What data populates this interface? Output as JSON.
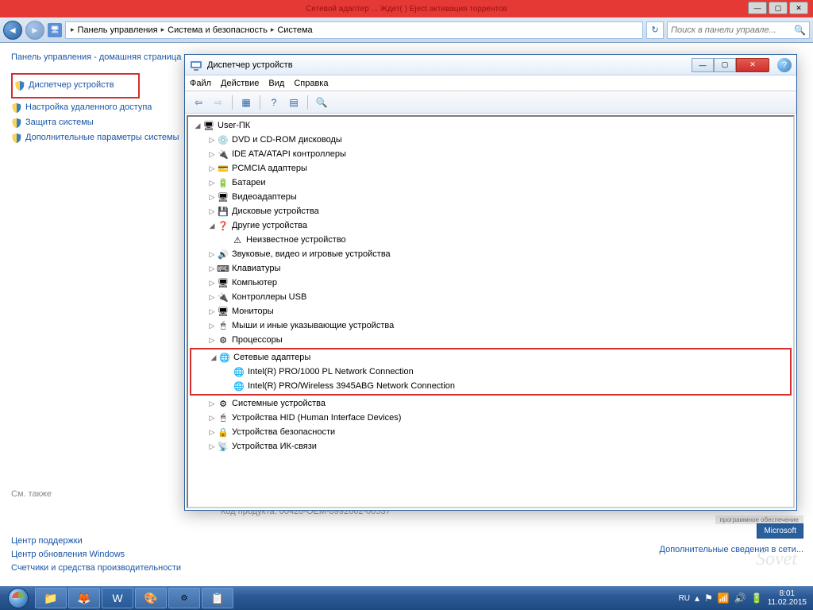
{
  "banner": {
    "center_text": "Сетевой адаптер ... Ждет( ) Eject активация торрентов",
    "min": "—",
    "max": "▢",
    "close": "✕"
  },
  "breadcrumb": {
    "items": [
      "Панель управления",
      "Система и безопасность",
      "Система"
    ]
  },
  "search": {
    "placeholder": "Поиск в панели управле..."
  },
  "sidebar": {
    "home": "Панель управления - домашняя страница",
    "device_manager": "Диспетчер устройств",
    "remote": "Настройка удаленного доступа",
    "protection": "Защита системы",
    "advanced": "Дополнительные параметры системы",
    "see_also": "См. также",
    "action_center": "Центр поддержки",
    "windows_update": "Центр обновления Windows",
    "perf": "Счетчики и средства производительности"
  },
  "main": {
    "product_key": "Код продукта: 00426-OEM-8992662-00537",
    "ms_badge_label": "программное обеспечение",
    "ms_badge": "Microsoft",
    "more": "Дополнительные сведения в сети..."
  },
  "dm": {
    "title": "Диспетчер устройств",
    "menu": [
      "Файл",
      "Действие",
      "Вид",
      "Справка"
    ],
    "root": "User-ПК",
    "categories": [
      "DVD и CD-ROM дисководы",
      "IDE ATA/ATAPI контроллеры",
      "PCMCIA адаптеры",
      "Батареи",
      "Видеоадаптеры",
      "Дисковые устройства",
      "Другие устройства",
      "Звуковые, видео и игровые устройства",
      "Клавиатуры",
      "Компьютер",
      "Контроллеры USB",
      "Мониторы",
      "Мыши и иные указывающие устройства",
      "Процессоры"
    ],
    "other_child": "Неизвестное устройство",
    "net_cat": "Сетевые адаптеры",
    "net_children": [
      "Intel(R) PRO/1000 PL Network Connection",
      "Intel(R) PRO/Wireless 3945ABG Network Connection"
    ],
    "after_net": [
      "Системные устройства",
      "Устройства HID (Human Interface Devices)",
      "Устройства безопасности",
      "Устройства ИК-связи"
    ]
  },
  "tray": {
    "lang": "RU",
    "time": "8:01",
    "date": "11.02.2015"
  },
  "watermark": "Sovet"
}
